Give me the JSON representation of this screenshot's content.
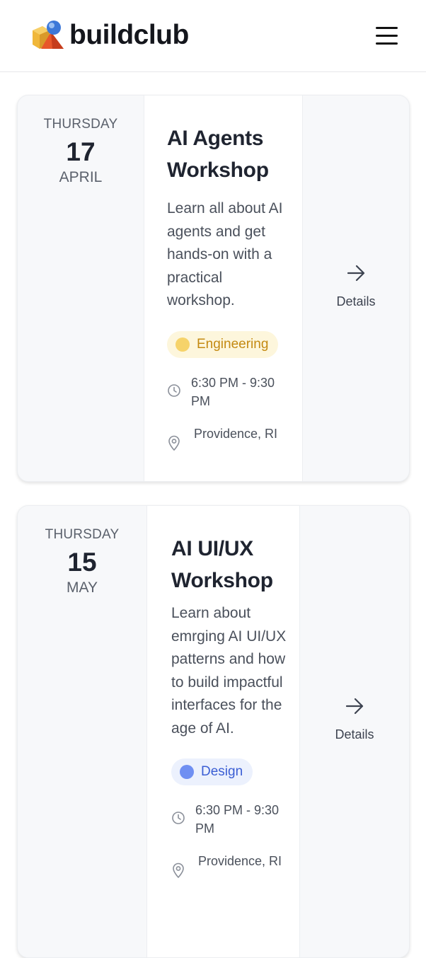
{
  "header": {
    "brand": "buildclub",
    "menu_icon": "hamburger-menu-icon"
  },
  "events": [
    {
      "weekday": "THURSDAY",
      "day": "17",
      "month": "APRIL",
      "title": "AI Agents Workshop",
      "description": "Learn all about AI agents and get hands-on with a practical workshop.",
      "tag": "Engineering",
      "tag_color": "#c48a12",
      "time": "6:30 PM - 9:30 PM",
      "location": "Providence, RI",
      "details_label": "Details"
    },
    {
      "weekday": "THURSDAY",
      "day": "15",
      "month": "MAY",
      "title": "AI UI/UX Workshop",
      "description": "Learn about emrging AI UI/UX patterns and how to build impactful interfaces for the age of AI.",
      "tag": "Design",
      "tag_color": "#3b5ed4",
      "time": "6:30 PM - 9:30 PM",
      "location": "Providence, RI",
      "details_label": "Details"
    }
  ]
}
